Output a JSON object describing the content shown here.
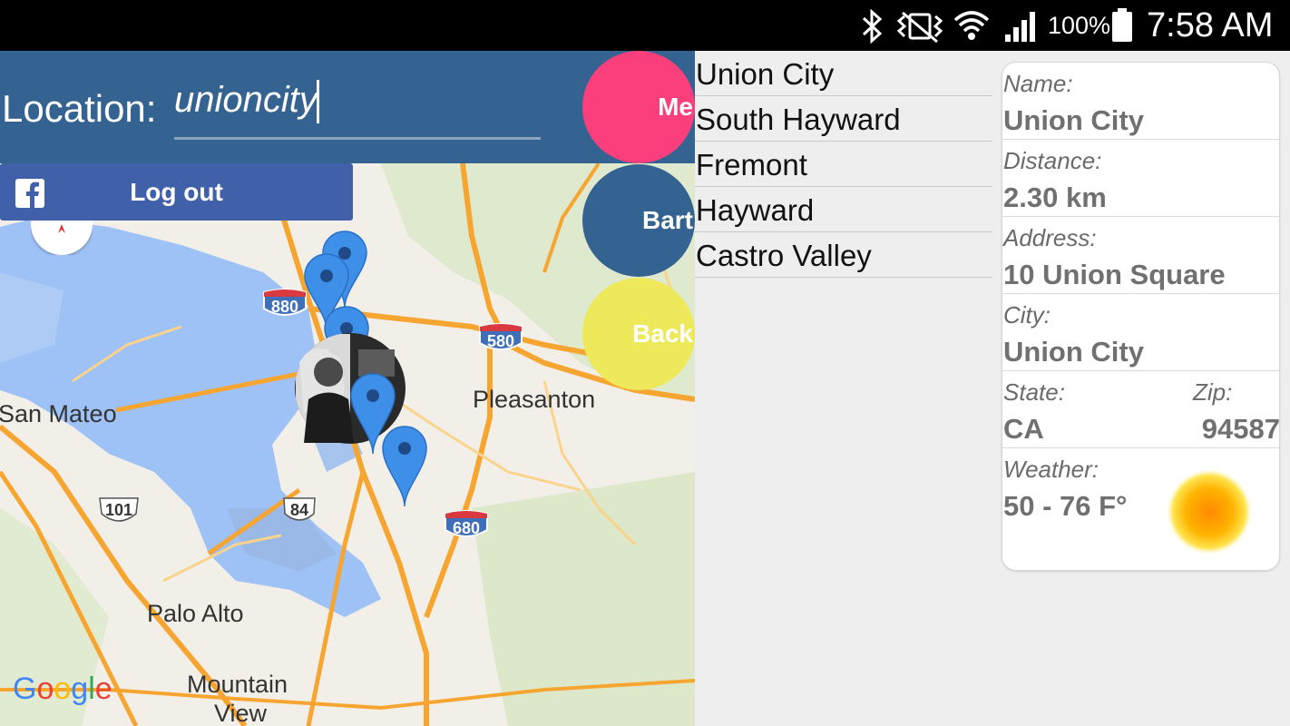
{
  "status_bar": {
    "battery_percent": "100%",
    "time": "7:58 AM",
    "icons": [
      "bluetooth-icon",
      "vibrate-icon",
      "wifi-icon",
      "signal-icon",
      "battery-icon"
    ]
  },
  "location": {
    "label": "Location:",
    "value": "unioncity"
  },
  "facebook": {
    "logout_label": "Log out",
    "color": "#4160aa"
  },
  "fabs": {
    "me_label": "Me",
    "bart_label": "Bart",
    "back_label": "Back",
    "me_color": "#fb3f7c",
    "bart_color": "#346391",
    "back_color": "#eee95a"
  },
  "map": {
    "labels": {
      "san_mateo": "San Mateo",
      "pleasanton": "Pleasanton",
      "palo_alto": "Palo Alto",
      "mountain_view_1": "Mountain",
      "mountain_view_2": "View"
    },
    "highways": {
      "h880": "880",
      "h580": "580",
      "h680": "680",
      "h101": "101",
      "h84": "84"
    },
    "attribution": "Google"
  },
  "cities": [
    "Union City",
    "South Hayward",
    "Fremont",
    "Hayward",
    "Castro Valley"
  ],
  "details": {
    "name_label": "Name:",
    "name": "Union City",
    "distance_label": "Distance:",
    "distance": "2.30 km",
    "address_label": "Address:",
    "address": "10 Union Square",
    "city_label": "City:",
    "city": "Union City",
    "state_label": "State:",
    "state": "CA",
    "zip_label": "Zip:",
    "zip": "94587",
    "weather_label": "Weather:",
    "weather": "50 - 76 F°",
    "weather_icon": "sun-icon"
  }
}
